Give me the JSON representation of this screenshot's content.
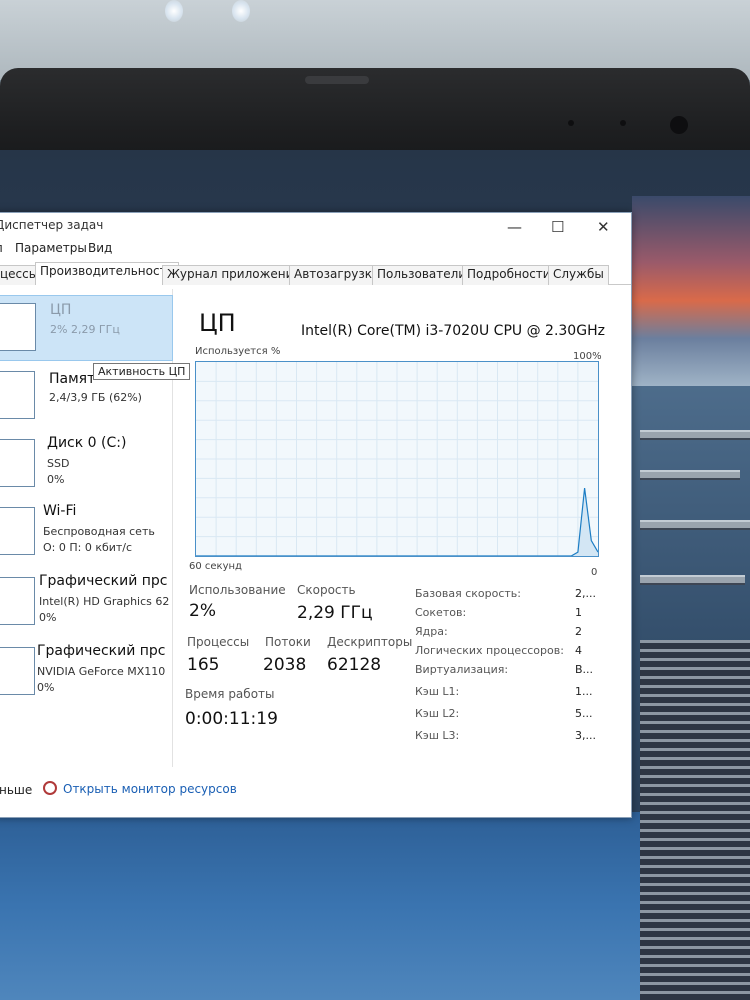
{
  "window": {
    "title": "Диспетчер задач",
    "minimize_icon": "—",
    "maximize_icon": "☐",
    "close_icon": "✕"
  },
  "menu": [
    "Параметры",
    "Вид"
  ],
  "menu_cut": "л",
  "tabs": [
    "цессы",
    "Производительность",
    "Журнал приложений",
    "Автозагрузка",
    "Пользователи",
    "Подробности",
    "Службы"
  ],
  "sidebar": {
    "items": [
      {
        "name": "ЦП",
        "sub1": "2% 2,29 ГГц",
        "sub2": ""
      },
      {
        "name": "Памят",
        "sub1": "2,4/3,9 ГБ (62%)",
        "sub2": ""
      },
      {
        "name": "Диск 0 (C:)",
        "sub1": "SSD",
        "sub2": "0%"
      },
      {
        "name": "Wi-Fi",
        "sub1": "Беспроводная сеть",
        "sub2": "О: 0 П: 0 кбит/с"
      },
      {
        "name": "Графический прс",
        "sub1": "Intel(R) HD Graphics 62",
        "sub2": "0%"
      },
      {
        "name": "Графический прс",
        "sub1": "NVIDIA GeForce MX110",
        "sub2": "0%"
      }
    ],
    "tooltip": "Активность ЦП"
  },
  "main": {
    "title": "ЦП",
    "cpu_name": "Intel(R) Core(TM) i3-7020U CPU @ 2.30GHz",
    "graph_label": "Используется %",
    "graph_max": "100%",
    "graph_time": "60 секунд",
    "graph_zero": "0",
    "stats": {
      "usage_label": "Использование",
      "usage_value": "2%",
      "speed_label": "Скорость",
      "speed_value": "2,29 ГГц",
      "processes_label": "Процессы",
      "processes_value": "165",
      "threads_label": "Потоки",
      "threads_value": "2038",
      "handles_label": "Дескрипторы",
      "handles_value": "62128",
      "uptime_label": "Время работы",
      "uptime_value": "0:00:11:19"
    },
    "details": [
      {
        "label": "Базовая скорость:",
        "value": "2,..."
      },
      {
        "label": "Сокетов:",
        "value": "1"
      },
      {
        "label": "Ядра:",
        "value": "2"
      },
      {
        "label": "Логических процессоров:",
        "value": "4"
      },
      {
        "label": "Виртуализация:",
        "value": "В..."
      },
      {
        "label": "Кэш L1:",
        "value": "1..."
      },
      {
        "label": "Кэш L2:",
        "value": "5..."
      },
      {
        "label": "Кэш L3:",
        "value": "3,..."
      }
    ]
  },
  "footer": {
    "less": "ньше",
    "resource_monitor": "Открыть монитор ресурсов"
  },
  "cpu_history_percent": [
    0,
    0,
    0,
    0,
    0,
    0,
    0,
    0,
    0,
    0,
    0,
    0,
    0,
    0,
    0,
    0,
    0,
    0,
    0,
    0,
    0,
    0,
    0,
    0,
    0,
    0,
    0,
    0,
    0,
    0,
    0,
    0,
    0,
    0,
    0,
    0,
    0,
    0,
    0,
    0,
    0,
    0,
    0,
    0,
    0,
    0,
    0,
    0,
    0,
    0,
    0,
    0,
    0,
    0,
    0,
    0,
    0,
    2,
    35,
    8,
    2
  ]
}
